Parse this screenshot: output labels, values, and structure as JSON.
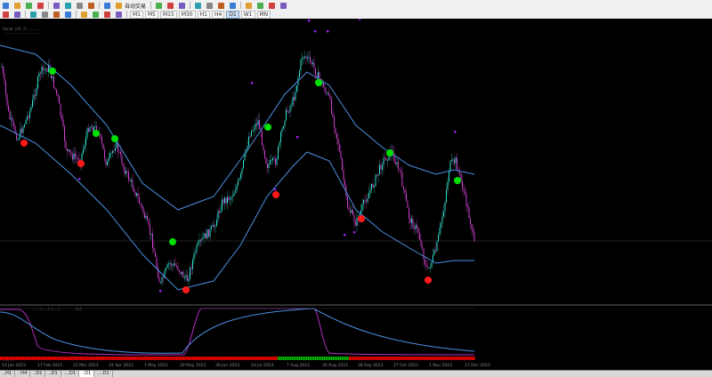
{
  "toolbar": {
    "autotrade_label": "自动交易",
    "timeframes": [
      "M1",
      "M5",
      "M15",
      "M30",
      "H1",
      "H4",
      "D1",
      "W1",
      "MN"
    ],
    "active_timeframe": "D1",
    "row1_icons": [
      "new-chart-icon",
      "profiles-icon",
      "market-watch-icon",
      "navigator-icon",
      "terminal-icon",
      "strategy-tester-icon",
      "data-window-icon",
      "new-order-icon",
      "metaeditor-icon",
      "autotrading-icon",
      "bar-chart-icon",
      "candlestick-icon",
      "line-chart-icon",
      "zoom-in-icon",
      "zoom-out-icon",
      "tile-windows-icon",
      "chart-shift-icon",
      "autoscroll-icon",
      "indicators-icon",
      "period-icon",
      "templates-icon"
    ],
    "row2_icons": [
      "cursor-icon",
      "crosshair-icon",
      "vertical-line-icon",
      "horizontal-line-icon",
      "trendline-icon",
      "equidistant-channel-icon",
      "fibonacci-icon",
      "text-icon",
      "text-label-icon",
      "arrows-icon"
    ]
  },
  "chart": {
    "info_line1": "Bands (20, 2) ............",
    "info_line2": "......... ........................",
    "indicator_label": "......(.....)..(.....)",
    "indicator_levels": "-1.0",
    "indicator_bottom_label": "..........",
    "colors": {
      "background": "#000000",
      "bull_candle": "#2fe0d0",
      "bear_candle": "#d040d0",
      "band": "#4a90e2",
      "buy_dot": "#00e000",
      "sell_dot": "#ff1a1a",
      "marker": "#a020f0",
      "bar_red": "#ff0000",
      "bar_green": "#00c000"
    }
  },
  "dates": [
    "13 Jan 2023",
    "17 Feb 2023",
    "22 Mar 2023",
    "24 Apr 2023",
    "1 May 2023",
    "29 May 2023",
    "30 Jun 2023",
    "24 Jul 2023",
    "7 Aug 2023",
    "30 Aug 2023",
    "28 Sep 2023",
    "27 Oct 2023",
    "1 Nov 2023",
    "27 Dec 2023"
  ],
  "tabs": [
    "..H1",
    "..H4",
    "..D1",
    "..D1",
    "....D1",
    "..D1",
    "....D1"
  ],
  "active_tab": 5
}
